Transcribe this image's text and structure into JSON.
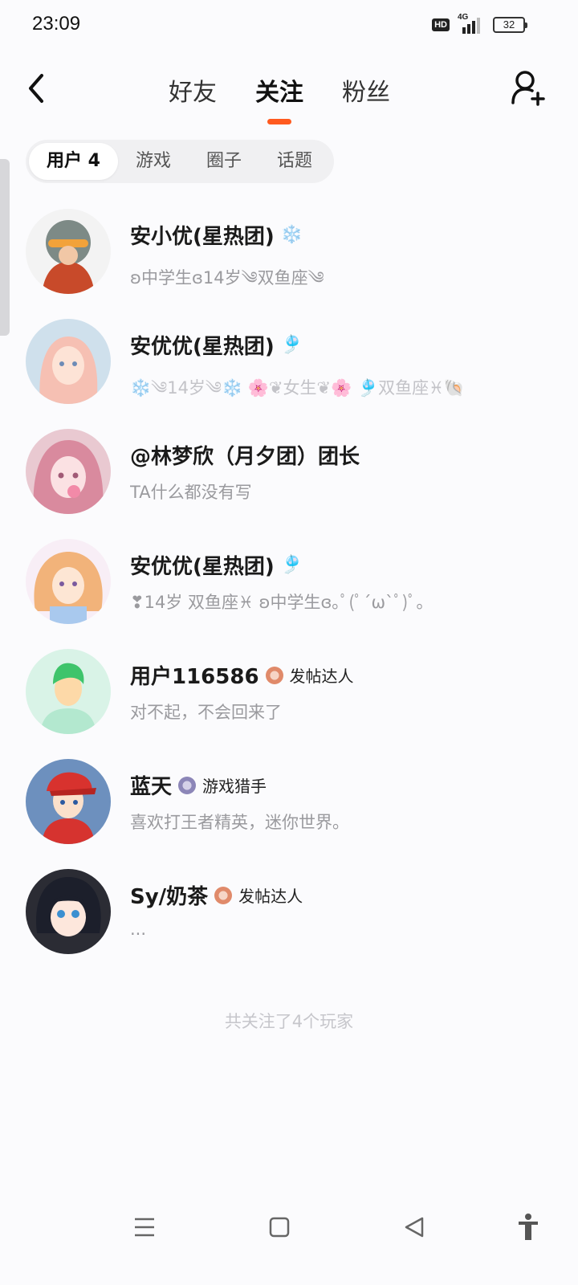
{
  "status": {
    "time": "23:09",
    "hd": "HD",
    "network": "4G",
    "battery": "32"
  },
  "nav": {
    "tabs": [
      {
        "label": "好友",
        "active": false
      },
      {
        "label": "关注",
        "active": true
      },
      {
        "label": "粉丝",
        "active": false
      }
    ],
    "accent_color": "#ff5a1f"
  },
  "subtabs": [
    {
      "label": "用户 4",
      "active": true
    },
    {
      "label": "游戏",
      "active": false
    },
    {
      "label": "圈子",
      "active": false
    },
    {
      "label": "话题",
      "active": false
    }
  ],
  "users": [
    {
      "name": "安小优(星热团)",
      "name_icon": "❄️",
      "signature": "ʚ中学生ɞ14岁༄双鱼座༄",
      "faint": false
    },
    {
      "name": "安优优(星热团)",
      "name_icon": "🎐",
      "signature": "❄️༄14岁༄❄️ 🌸❦女生❦🌸 🎐双鱼座♓🐚",
      "faint": true
    },
    {
      "name": "@林梦欣（月夕团）团长",
      "name_icon": "",
      "signature": "TA什么都没有写",
      "faint": false
    },
    {
      "name": "安优优(星热团)",
      "name_icon": "🎐",
      "signature": "❣14岁 双鱼座♓ ʚ中学生ɞ｡ﾟ(ﾟ´ω`ﾟ)ﾟ｡",
      "faint": false
    },
    {
      "name": "用户116586",
      "name_icon": "",
      "badge": "发帖达人",
      "badge_color": "#e08a6a",
      "signature": "对不起，不会回来了",
      "faint": false
    },
    {
      "name": "蓝天",
      "name_icon": "",
      "badge": "游戏猎手",
      "badge_color": "#8c86b8",
      "signature": "喜欢打王者精英，迷你世界。",
      "faint": false
    },
    {
      "name": "Sy/奶茶",
      "name_icon": "",
      "badge": "发帖达人",
      "badge_color": "#e08a6a",
      "signature": "...",
      "faint": false
    }
  ],
  "footer": "共关注了4个玩家"
}
